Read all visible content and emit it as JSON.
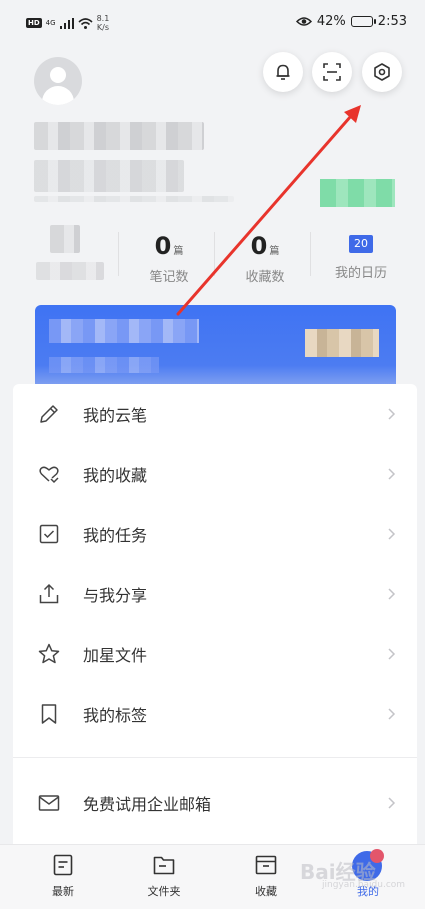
{
  "status_bar": {
    "network": "HD",
    "signal": "4G",
    "speed_value": "8.1",
    "speed_unit": "K/s",
    "battery_percent": "42%",
    "battery_level": 0.42,
    "time": "2:53"
  },
  "header_buttons": {
    "notification_icon": "bell-icon",
    "scan_icon": "scan-icon",
    "settings_icon": "settings-hexagon-icon"
  },
  "stats": [
    {
      "value": "0",
      "unit": "篇",
      "label": "笔记数"
    },
    {
      "value": "0",
      "unit": "篇",
      "label": "收藏数"
    },
    {
      "value": "20",
      "label": "我的日历"
    }
  ],
  "menu": {
    "items": [
      {
        "label": "我的云笔",
        "icon": "pencil-icon"
      },
      {
        "label": "我的收藏",
        "icon": "heart-icon"
      },
      {
        "label": "我的任务",
        "icon": "checkbox-icon"
      },
      {
        "label": "与我分享",
        "icon": "share-upload-icon"
      },
      {
        "label": "加星文件",
        "icon": "star-icon"
      },
      {
        "label": "我的标签",
        "icon": "bookmark-icon"
      }
    ],
    "extra": {
      "label": "免费试用企业邮箱",
      "icon": "mail-icon"
    }
  },
  "bottom_nav": {
    "items": [
      {
        "label": "最新",
        "icon": "document-icon"
      },
      {
        "label": "文件夹",
        "icon": "folder-icon"
      },
      {
        "label": "收藏",
        "icon": "archive-box-icon"
      },
      {
        "label": "我的",
        "icon": "profile-avatar-icon"
      }
    ],
    "active": "我的"
  },
  "watermark": {
    "text": "Bai经验",
    "sub": "jingyan.baidu.com"
  },
  "colors": {
    "accent": "#3f6ae8",
    "banner": "#4677f3",
    "annotation_arrow": "#e8342c"
  }
}
